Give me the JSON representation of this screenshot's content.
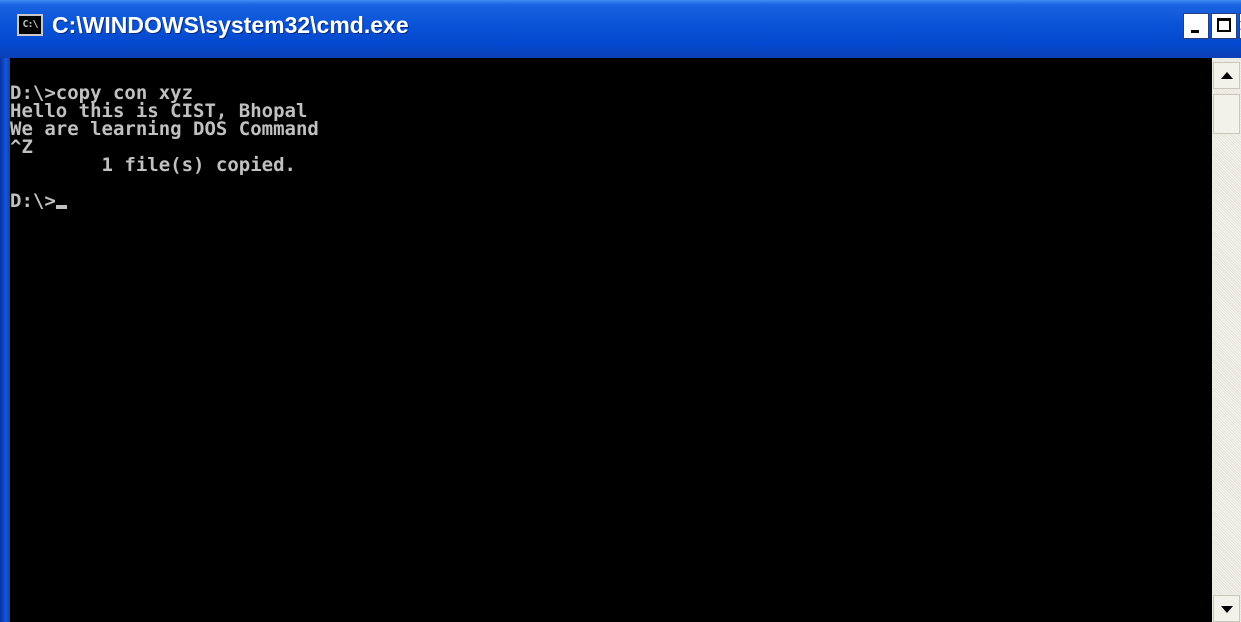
{
  "window": {
    "title": "C:\\WINDOWS\\system32\\cmd.exe",
    "icon_text": "C:\\",
    "close_glyph": "×"
  },
  "console": {
    "lines": [
      "D:\\>copy con xyz",
      "Hello this is CIST, Bhopal",
      "We are learning DOS Command",
      "^Z",
      "        1 file(s) copied.",
      "",
      "D:\\>"
    ]
  },
  "colors": {
    "titlebar": "#0a54d8",
    "console_bg": "#000000",
    "console_text": "#c0c0c0"
  }
}
